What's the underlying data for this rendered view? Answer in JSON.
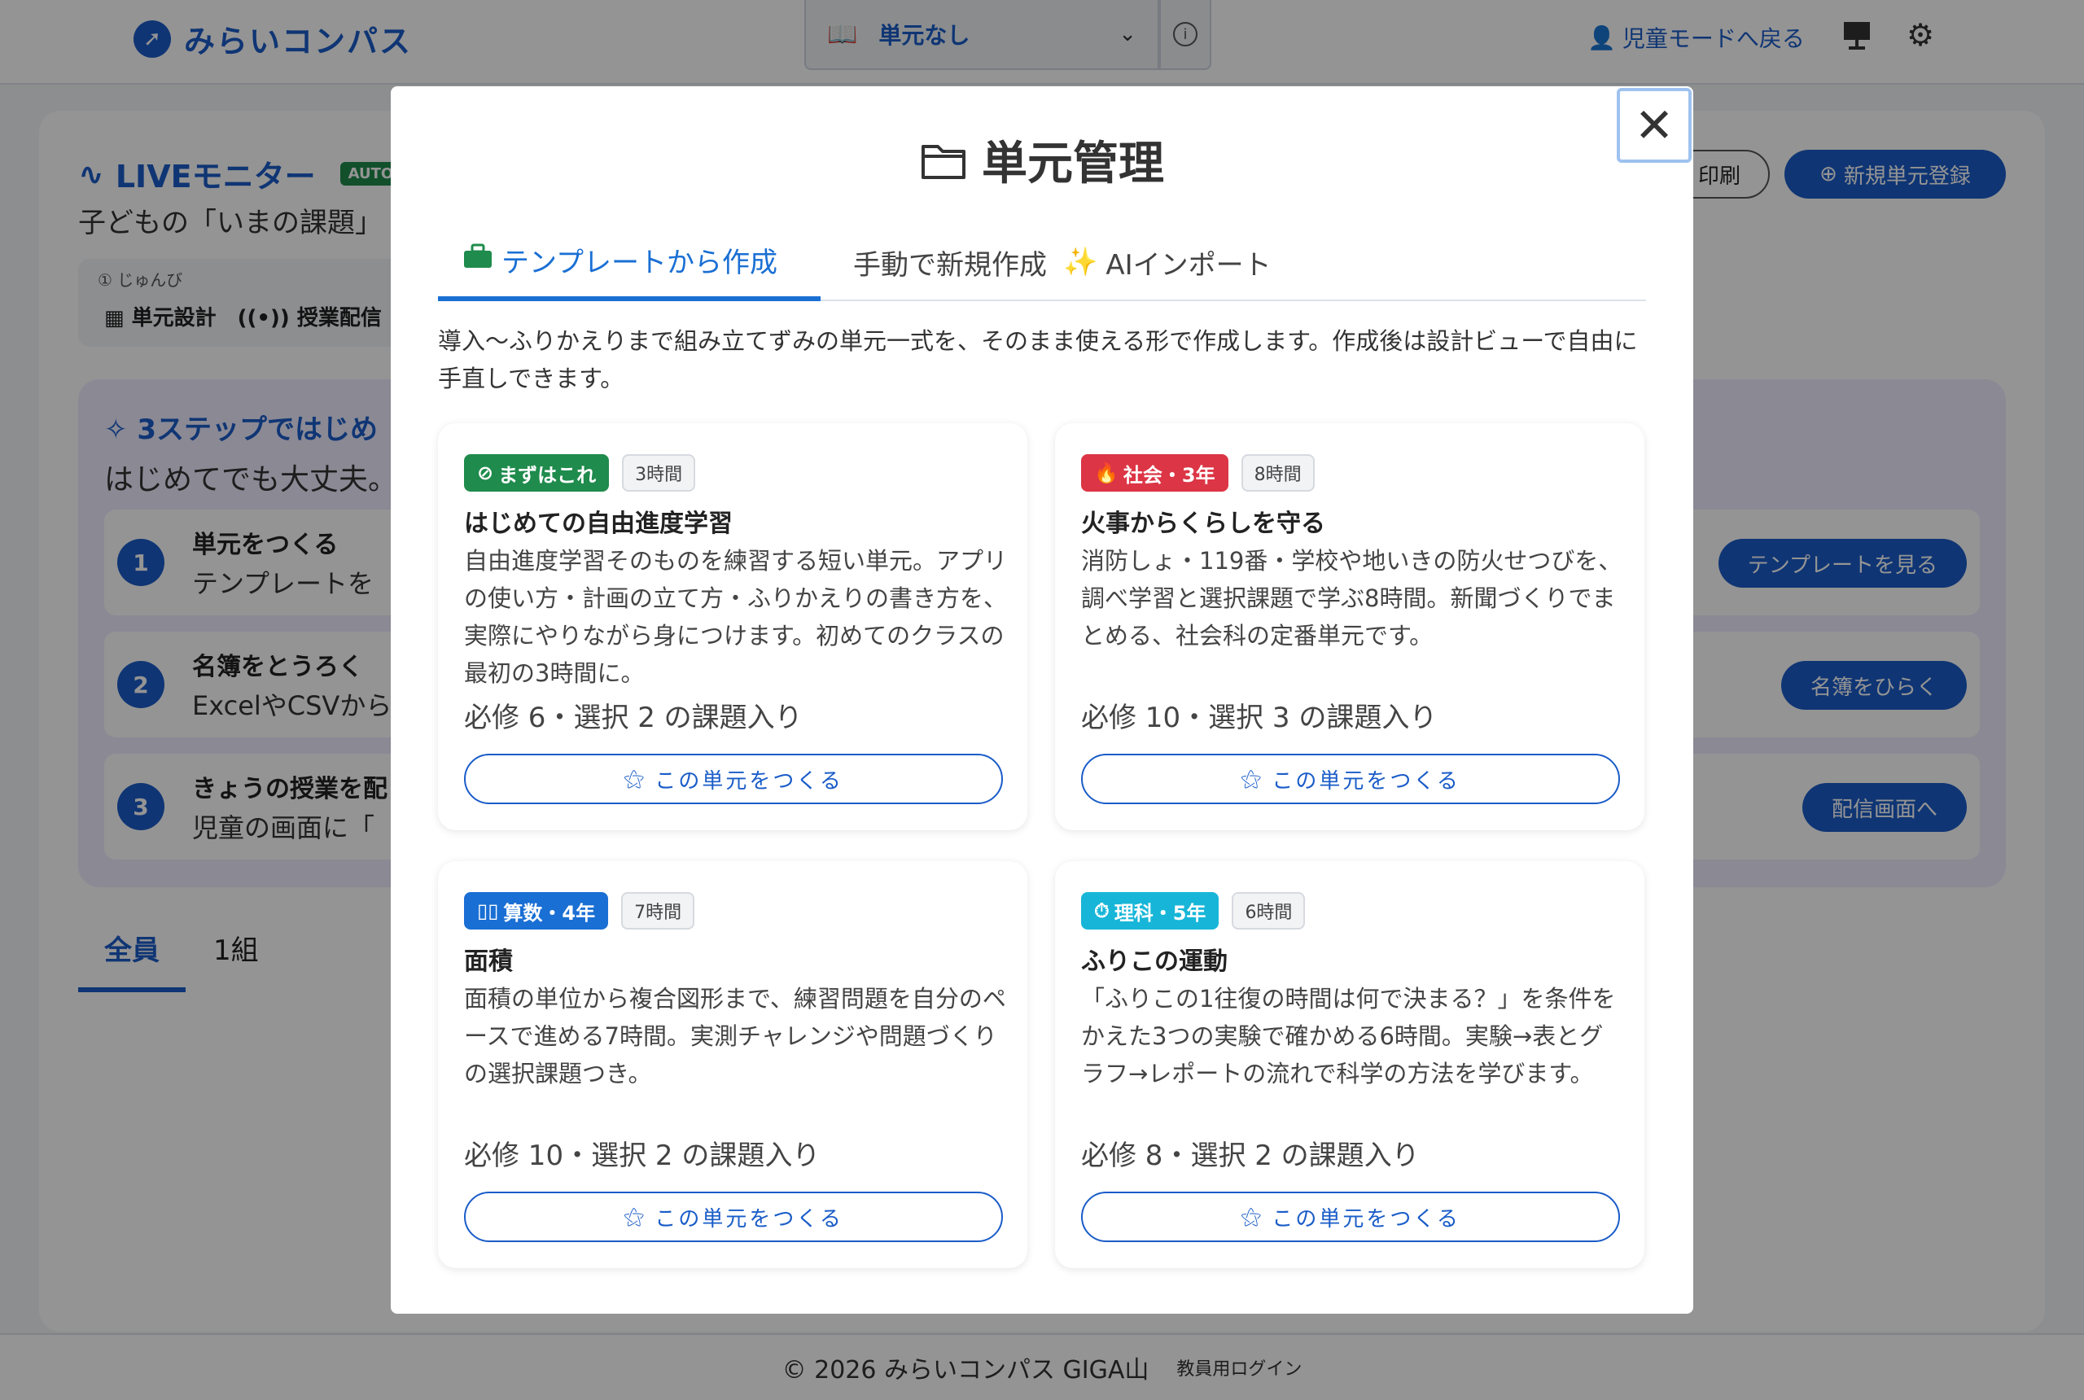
{
  "colors": {
    "primary": "#1a5cc8",
    "tab_active": "#1a6fd4",
    "badge_start": "#1f8b4c",
    "badge_social": "#dc3545",
    "badge_math": "#1a6fd4",
    "badge_science": "#17b6d8"
  },
  "header": {
    "app_name": "みらいコンパス",
    "unit_select_value": "単元なし",
    "child_mode_label": "児童モードへ戻る"
  },
  "background": {
    "live_title": "LIVEモニター",
    "auto_badge": "AUTO",
    "subtitle": "子どもの「いまの課題」",
    "steps_label": "① じゅんび",
    "steps_item_1": "単元設計",
    "steps_item_2": "授業配信",
    "print_button": "印刷",
    "new_unit_button": "新規単元登録",
    "intro_title": "3ステップではじめ",
    "intro_sub": "はじめてでも大丈夫。",
    "steps": [
      {
        "num": "1",
        "title": "単元をつくる",
        "desc": "テンプレートを",
        "button": "テンプレートを見る"
      },
      {
        "num": "2",
        "title": "名簿をとうろく",
        "desc": "ExcelやCSVから",
        "button": "名簿をひらく"
      },
      {
        "num": "3",
        "title": "きょうの授業を配",
        "desc": "児童の画面に「",
        "button": "配信画面へ"
      }
    ],
    "tab_all": "全員",
    "tab_class1": "1組",
    "footer_copy": "© 2026 みらいコンパス GIGA山",
    "footer_login": "教員用ログイン"
  },
  "modal": {
    "title": "単元管理",
    "close_label": "✕",
    "tabs": [
      {
        "label": "テンプレートから作成"
      },
      {
        "label": "手動で新規作成"
      },
      {
        "label": "AIインポート"
      }
    ],
    "description": "導入〜ふりかえりまで組み立てずみの単元一式を、そのまま使える形で作成します。作成後は設計ビューで自由に手直しできます。",
    "cards": [
      {
        "badge": "まずはこれ",
        "hours": "3時間",
        "title": "はじめての自由進度学習",
        "desc": "自由進度学習そのものを練習する短い単元。アプリの使い方・計画の立て方・ふりかえりの書き方を、実際にやりながら身につけます。初めてのクラスの最初の3時間に。",
        "count": "必修 6・選択 2 の課題入り",
        "button": "この単元をつくる"
      },
      {
        "badge": "社会・3年",
        "hours": "8時間",
        "title": "火事からくらしを守る",
        "desc": "消防しょ・119番・学校や地いきの防火せつびを、調べ学習と選択課題で学ぶ8時間。新聞づくりでまとめる、社会科の定番単元です。",
        "count": "必修 10・選択 3 の課題入り",
        "button": "この単元をつくる"
      },
      {
        "badge": "算数・4年",
        "hours": "7時間",
        "title": "面積",
        "desc": "面積の単位から複合図形まで、練習問題を自分のペースで進める7時間。実測チャレンジや問題づくりの選択課題つき。",
        "count": "必修 10・選択 2 の課題入り",
        "button": "この単元をつくる"
      },
      {
        "badge": "理科・5年",
        "hours": "6時間",
        "title": "ふりこの運動",
        "desc": "「ふりこの1往復の時間は何で決まる？」を条件をかえた3つの実験で確かめる6時間。実験→表とグラフ→レポートの流れで科学の方法を学びます。",
        "count": "必修 8・選択 2 の課題入り",
        "button": "この単元をつくる"
      }
    ]
  }
}
